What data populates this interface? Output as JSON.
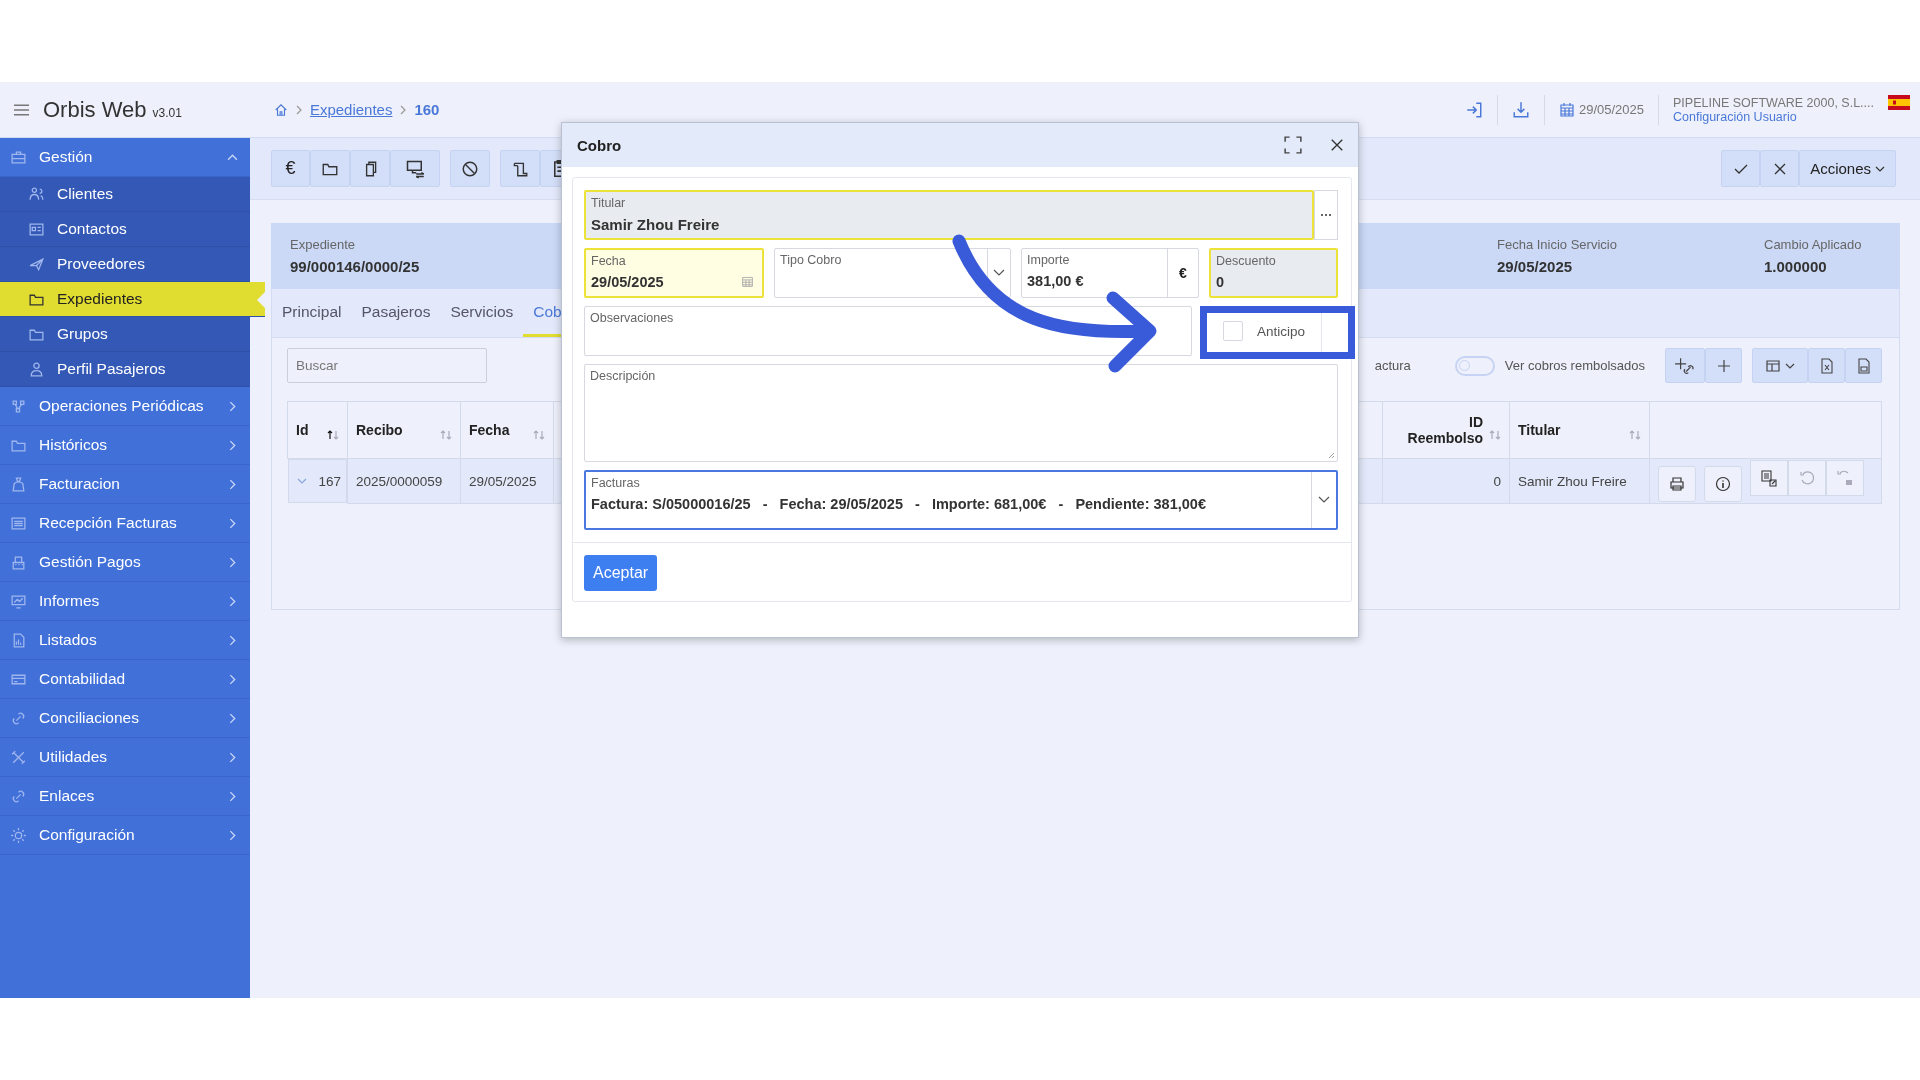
{
  "app": {
    "name": "Orbis Web",
    "version": "v3.01"
  },
  "breadcrumb": [
    {
      "label": "Expedientes",
      "kind": "link"
    },
    {
      "label": "160",
      "kind": "current"
    }
  ],
  "header_right": {
    "date": "29/05/2025",
    "company": "PIPELINE SOFTWARE 2000, S.L....",
    "user_link": "Configuración Usuario"
  },
  "sidebar": {
    "items": [
      {
        "label": "Gestión",
        "expanded": true,
        "children": [
          {
            "label": "Clientes",
            "selected": false
          },
          {
            "label": "Contactos",
            "selected": false
          },
          {
            "label": "Proveedores",
            "selected": false
          },
          {
            "label": "Expedientes",
            "selected": true
          },
          {
            "label": "Grupos",
            "selected": false
          },
          {
            "label": "Perfil Pasajeros",
            "selected": false
          }
        ]
      },
      {
        "label": "Operaciones Periódicas",
        "expanded": false
      },
      {
        "label": "Históricos",
        "expanded": false
      },
      {
        "label": "Facturacion",
        "expanded": false
      },
      {
        "label": "Recepción Facturas",
        "expanded": false
      },
      {
        "label": "Gestión Pagos",
        "expanded": false
      },
      {
        "label": "Informes",
        "expanded": false
      },
      {
        "label": "Listados",
        "expanded": false
      },
      {
        "label": "Contabilidad",
        "expanded": false
      },
      {
        "label": "Conciliaciones",
        "expanded": false
      },
      {
        "label": "Utilidades",
        "expanded": false
      },
      {
        "label": "Enlaces",
        "expanded": false
      },
      {
        "label": "Configuración",
        "expanded": false
      }
    ]
  },
  "toolbar": {
    "currency_button": "€",
    "actions_button": "Acciones"
  },
  "expediente": {
    "fields": [
      {
        "label": "Expediente",
        "value": "99/000146/0000/25"
      },
      {
        "label": "Fecha Inicio Servicio",
        "value": "29/05/2025"
      },
      {
        "label": "Cambio Aplicado",
        "value": "1.000000"
      }
    ]
  },
  "tabs": [
    {
      "label": "Principal",
      "selected": false
    },
    {
      "label": "Pasajeros",
      "selected": false
    },
    {
      "label": "Servicios",
      "selected": false
    },
    {
      "label": "Cob",
      "selected": true
    }
  ],
  "search": {
    "placeholder": "Buscar"
  },
  "filters": {
    "partial_label": "actura",
    "toggle": {
      "label": "Ver cobros rembolsados",
      "on": false
    }
  },
  "table": {
    "columns": [
      {
        "label": "Id",
        "sorted": true
      },
      {
        "label": "Recibo",
        "sorted": false
      },
      {
        "label": "Fecha",
        "sorted": false
      },
      {
        "label": "ID Reembolso",
        "sorted": false
      },
      {
        "label": "Titular",
        "sorted": false
      }
    ],
    "rows": [
      {
        "expanded": false,
        "id": "167",
        "recibo": "2025/0000059",
        "fecha": "29/05/2025",
        "id_reembolso": "0",
        "titular": "Samir Zhou Freire",
        "actions": [
          {
            "disabled": false
          },
          {
            "disabled": false
          },
          {
            "disabled": false
          },
          {
            "disabled": true
          },
          {
            "disabled": true
          }
        ]
      }
    ]
  },
  "modal": {
    "title": "Cobro",
    "titular": {
      "label": "Titular",
      "value": "Samir Zhou Freire",
      "highlighted": true
    },
    "fecha": {
      "label": "Fecha",
      "value": "29/05/2025",
      "highlighted": true
    },
    "tipo_cobro": {
      "label": "Tipo Cobro",
      "highlighted": false
    },
    "importe": {
      "label": "Importe",
      "value": "381,00 €",
      "addon": "€",
      "highlighted": false
    },
    "descuento": {
      "label": "Descuento",
      "value": "0",
      "highlighted": true
    },
    "observaciones": {
      "label": "Observaciones"
    },
    "anticipo": {
      "label": "Anticipo",
      "checked": false
    },
    "descripcion": {
      "label": "Descripción"
    },
    "facturas": {
      "label": "Facturas",
      "value": "Factura: S/05000016/25   -   Fecha: 29/05/2025   -   Importe: 681,00€   -   Pendiente: 381,00€",
      "focused": true
    },
    "accept": "Aceptar"
  }
}
